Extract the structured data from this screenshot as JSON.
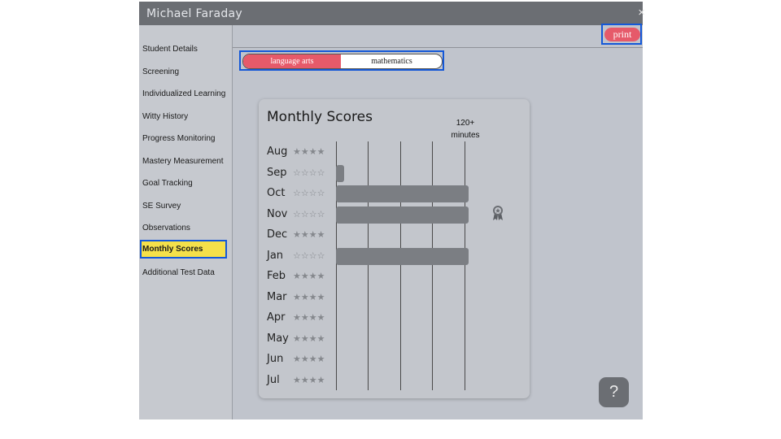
{
  "window": {
    "title": "Michael Faraday",
    "close": "×"
  },
  "sidebar": {
    "items": [
      {
        "label": "Student Details"
      },
      {
        "label": "Screening"
      },
      {
        "label": "Individualized Learning"
      },
      {
        "label": "Witty History"
      },
      {
        "label": "Progress Monitoring"
      },
      {
        "label": "Mastery Measurement"
      },
      {
        "label": "Goal Tracking"
      },
      {
        "label": "SE Survey"
      },
      {
        "label": "Observations"
      },
      {
        "label": "Monthly Scores",
        "active": true
      },
      {
        "label": "Additional Test Data"
      }
    ]
  },
  "toolbar": {
    "print_label": "print"
  },
  "subjects": {
    "active": "language arts",
    "language_arts": "language arts",
    "mathematics": "mathematics"
  },
  "card": {
    "title": "Monthly Scores",
    "minutes_line1": "120+",
    "minutes_line2": "minutes"
  },
  "months": [
    {
      "name": "Aug",
      "stars": "★★★★",
      "minutes_fraction": 0
    },
    {
      "name": "Sep",
      "stars": "☆☆☆☆",
      "minutes_fraction": 0.06
    },
    {
      "name": "Oct",
      "stars": "☆☆☆☆",
      "minutes_fraction": 1.0
    },
    {
      "name": "Nov",
      "stars": "☆☆☆☆",
      "minutes_fraction": 1.0,
      "award": true
    },
    {
      "name": "Dec",
      "stars": "★★★★",
      "minutes_fraction": 0
    },
    {
      "name": "Jan",
      "stars": "☆☆☆☆",
      "minutes_fraction": 1.0
    },
    {
      "name": "Feb",
      "stars": "★★★★",
      "minutes_fraction": 0
    },
    {
      "name": "Mar",
      "stars": "★★★★",
      "minutes_fraction": 0
    },
    {
      "name": "Apr",
      "stars": "★★★★",
      "minutes_fraction": 0
    },
    {
      "name": "May",
      "stars": "★★★★",
      "minutes_fraction": 0
    },
    {
      "name": "Jun",
      "stars": "★★★★",
      "minutes_fraction": 0
    },
    {
      "name": "Jul",
      "stars": "★★★★",
      "minutes_fraction": 0
    }
  ],
  "help": {
    "label": "?"
  },
  "colors": {
    "accent": "#e65a6a",
    "highlight": "#f5e04a",
    "focus": "#1458d8",
    "bar": "#7b7e83"
  }
}
